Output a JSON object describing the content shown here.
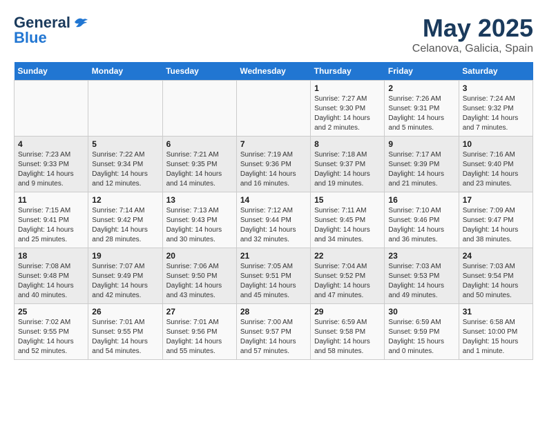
{
  "logo": {
    "general": "General",
    "blue": "Blue"
  },
  "title": "May 2025",
  "subtitle": "Celanova, Galicia, Spain",
  "weekdays": [
    "Sunday",
    "Monday",
    "Tuesday",
    "Wednesday",
    "Thursday",
    "Friday",
    "Saturday"
  ],
  "weeks": [
    [
      {
        "day": "",
        "info": ""
      },
      {
        "day": "",
        "info": ""
      },
      {
        "day": "",
        "info": ""
      },
      {
        "day": "",
        "info": ""
      },
      {
        "day": "1",
        "info": "Sunrise: 7:27 AM\nSunset: 9:30 PM\nDaylight: 14 hours\nand 2 minutes."
      },
      {
        "day": "2",
        "info": "Sunrise: 7:26 AM\nSunset: 9:31 PM\nDaylight: 14 hours\nand 5 minutes."
      },
      {
        "day": "3",
        "info": "Sunrise: 7:24 AM\nSunset: 9:32 PM\nDaylight: 14 hours\nand 7 minutes."
      }
    ],
    [
      {
        "day": "4",
        "info": "Sunrise: 7:23 AM\nSunset: 9:33 PM\nDaylight: 14 hours\nand 9 minutes."
      },
      {
        "day": "5",
        "info": "Sunrise: 7:22 AM\nSunset: 9:34 PM\nDaylight: 14 hours\nand 12 minutes."
      },
      {
        "day": "6",
        "info": "Sunrise: 7:21 AM\nSunset: 9:35 PM\nDaylight: 14 hours\nand 14 minutes."
      },
      {
        "day": "7",
        "info": "Sunrise: 7:19 AM\nSunset: 9:36 PM\nDaylight: 14 hours\nand 16 minutes."
      },
      {
        "day": "8",
        "info": "Sunrise: 7:18 AM\nSunset: 9:37 PM\nDaylight: 14 hours\nand 19 minutes."
      },
      {
        "day": "9",
        "info": "Sunrise: 7:17 AM\nSunset: 9:39 PM\nDaylight: 14 hours\nand 21 minutes."
      },
      {
        "day": "10",
        "info": "Sunrise: 7:16 AM\nSunset: 9:40 PM\nDaylight: 14 hours\nand 23 minutes."
      }
    ],
    [
      {
        "day": "11",
        "info": "Sunrise: 7:15 AM\nSunset: 9:41 PM\nDaylight: 14 hours\nand 25 minutes."
      },
      {
        "day": "12",
        "info": "Sunrise: 7:14 AM\nSunset: 9:42 PM\nDaylight: 14 hours\nand 28 minutes."
      },
      {
        "day": "13",
        "info": "Sunrise: 7:13 AM\nSunset: 9:43 PM\nDaylight: 14 hours\nand 30 minutes."
      },
      {
        "day": "14",
        "info": "Sunrise: 7:12 AM\nSunset: 9:44 PM\nDaylight: 14 hours\nand 32 minutes."
      },
      {
        "day": "15",
        "info": "Sunrise: 7:11 AM\nSunset: 9:45 PM\nDaylight: 14 hours\nand 34 minutes."
      },
      {
        "day": "16",
        "info": "Sunrise: 7:10 AM\nSunset: 9:46 PM\nDaylight: 14 hours\nand 36 minutes."
      },
      {
        "day": "17",
        "info": "Sunrise: 7:09 AM\nSunset: 9:47 PM\nDaylight: 14 hours\nand 38 minutes."
      }
    ],
    [
      {
        "day": "18",
        "info": "Sunrise: 7:08 AM\nSunset: 9:48 PM\nDaylight: 14 hours\nand 40 minutes."
      },
      {
        "day": "19",
        "info": "Sunrise: 7:07 AM\nSunset: 9:49 PM\nDaylight: 14 hours\nand 42 minutes."
      },
      {
        "day": "20",
        "info": "Sunrise: 7:06 AM\nSunset: 9:50 PM\nDaylight: 14 hours\nand 43 minutes."
      },
      {
        "day": "21",
        "info": "Sunrise: 7:05 AM\nSunset: 9:51 PM\nDaylight: 14 hours\nand 45 minutes."
      },
      {
        "day": "22",
        "info": "Sunrise: 7:04 AM\nSunset: 9:52 PM\nDaylight: 14 hours\nand 47 minutes."
      },
      {
        "day": "23",
        "info": "Sunrise: 7:03 AM\nSunset: 9:53 PM\nDaylight: 14 hours\nand 49 minutes."
      },
      {
        "day": "24",
        "info": "Sunrise: 7:03 AM\nSunset: 9:54 PM\nDaylight: 14 hours\nand 50 minutes."
      }
    ],
    [
      {
        "day": "25",
        "info": "Sunrise: 7:02 AM\nSunset: 9:55 PM\nDaylight: 14 hours\nand 52 minutes."
      },
      {
        "day": "26",
        "info": "Sunrise: 7:01 AM\nSunset: 9:55 PM\nDaylight: 14 hours\nand 54 minutes."
      },
      {
        "day": "27",
        "info": "Sunrise: 7:01 AM\nSunset: 9:56 PM\nDaylight: 14 hours\nand 55 minutes."
      },
      {
        "day": "28",
        "info": "Sunrise: 7:00 AM\nSunset: 9:57 PM\nDaylight: 14 hours\nand 57 minutes."
      },
      {
        "day": "29",
        "info": "Sunrise: 6:59 AM\nSunset: 9:58 PM\nDaylight: 14 hours\nand 58 minutes."
      },
      {
        "day": "30",
        "info": "Sunrise: 6:59 AM\nSunset: 9:59 PM\nDaylight: 15 hours\nand 0 minutes."
      },
      {
        "day": "31",
        "info": "Sunrise: 6:58 AM\nSunset: 10:00 PM\nDaylight: 15 hours\nand 1 minute."
      }
    ]
  ]
}
